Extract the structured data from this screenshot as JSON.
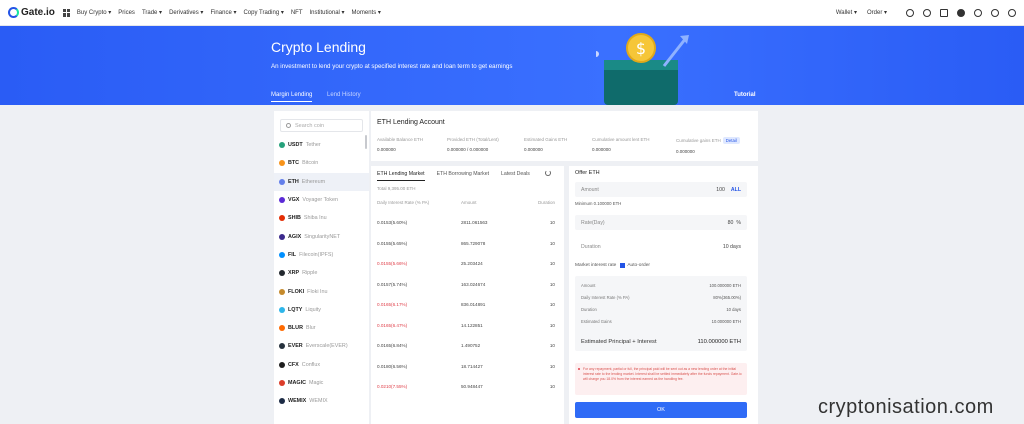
{
  "brand": {
    "name": "Gate.io"
  },
  "topnav": {
    "items": [
      "Buy Crypto ▾",
      "Prices",
      "Trade ▾",
      "Derivatives ▾",
      "Finance ▾",
      "Copy Trading ▾",
      "NFT",
      "Institutional ▾",
      "Moments ▾"
    ],
    "right_items": [
      "Wallet ▾",
      "Order ▾"
    ]
  },
  "hero": {
    "title": "Crypto Lending",
    "subtitle": "An investment to lend your crypto at specified interest rate and loan term to get earnings",
    "tabs": [
      "Margin Lending",
      "Lend History"
    ],
    "tutorial": "Tutorial"
  },
  "sidebar": {
    "search_placeholder": "Search coin",
    "coins": [
      {
        "symbol": "USDT",
        "name": "Tether",
        "color": "#26a17b"
      },
      {
        "symbol": "BTC",
        "name": "Bitcoin",
        "color": "#f7931a"
      },
      {
        "symbol": "ETH",
        "name": "Ethereum",
        "color": "#627eea"
      },
      {
        "symbol": "VGX",
        "name": "Voyager Token",
        "color": "#5b2ad6"
      },
      {
        "symbol": "SHIB",
        "name": "Shiba Inu",
        "color": "#e42d04"
      },
      {
        "symbol": "AGIX",
        "name": "SingularityNET",
        "color": "#3b2a8c"
      },
      {
        "symbol": "FIL",
        "name": "Filecoin(IPFS)",
        "color": "#0090ff"
      },
      {
        "symbol": "XRP",
        "name": "Ripple",
        "color": "#23292f"
      },
      {
        "symbol": "FLOKI",
        "name": "Floki Inu",
        "color": "#c58a2c"
      },
      {
        "symbol": "LQTY",
        "name": "Liquity",
        "color": "#2eb6ea"
      },
      {
        "symbol": "BLUR",
        "name": "Blur",
        "color": "#ff6a00"
      },
      {
        "symbol": "EVER",
        "name": "Everscale(EVER)",
        "color": "#26313d"
      },
      {
        "symbol": "CFX",
        "name": "Conflux",
        "color": "#1e1e1e"
      },
      {
        "symbol": "MAGIC",
        "name": "Magic",
        "color": "#dc3d2a"
      },
      {
        "symbol": "WEMIX",
        "name": "WEMIX",
        "color": "#1c2b45"
      }
    ]
  },
  "account": {
    "title": "ETH Lending Account",
    "stats": [
      {
        "label": "Available Balance ETH",
        "value": "0.000000"
      },
      {
        "label": "Provided ETH (Total/Lent)",
        "value": "0.000000 / 0.000000"
      },
      {
        "label": "Estimated Gains ETH",
        "value": "0.000000"
      },
      {
        "label": "Cumulative amount lent ETH",
        "value": "0.000000"
      },
      {
        "label": "Cumulative gains ETH",
        "value": "0.000000"
      }
    ],
    "detail_label": "Detail"
  },
  "market": {
    "tabs": [
      "ETH Lending Market",
      "ETH Borrowing Market",
      "Latest Deals"
    ],
    "total": "Total 9,395.00 ETH",
    "headers": [
      "Daily Interest Rate (% PA)",
      "Amount",
      "Duration"
    ],
    "rows": [
      {
        "rate": "0.0153(5.60%)",
        "amount": "2811.061563",
        "duration": "10",
        "red": false
      },
      {
        "rate": "0.0155(5.65%)",
        "amount": "865.729078",
        "duration": "10",
        "red": false
      },
      {
        "rate": "0.0155(5.66%)",
        "amount": "25.203424",
        "duration": "10",
        "red": true
      },
      {
        "rate": "0.0157(5.74%)",
        "amount": "163.024674",
        "duration": "10",
        "red": false
      },
      {
        "rate": "0.0165(6.17%)",
        "amount": "836.014891",
        "duration": "10",
        "red": true
      },
      {
        "rate": "0.0165(6.47%)",
        "amount": "14.122851",
        "duration": "10",
        "red": true
      },
      {
        "rate": "0.0165(6.84%)",
        "amount": "1.490752",
        "duration": "10",
        "red": false
      },
      {
        "rate": "0.0180(6.56%)",
        "amount": "18.714427",
        "duration": "10",
        "red": false
      },
      {
        "rate": "0.0210(7.55%)",
        "amount": "50.948447",
        "duration": "10",
        "red": true
      }
    ]
  },
  "offer": {
    "title": "Offer ETH",
    "amount_label": "Amount",
    "amount_value": "100",
    "all_label": "ALL",
    "minimum_note": "Minimum 0.100000 ETH",
    "rate_label": "Rate(Day)",
    "rate_value": "80",
    "rate_unit": "%",
    "duration_label": "Duration",
    "duration_value": "10 days",
    "market_rate_label": "Market interest rate",
    "auto_order_label": "Auto-order",
    "summary": [
      {
        "label": "Amount",
        "value": "100.000000 ETH"
      },
      {
        "label": "Daily Interest Rate (% PA)",
        "value": "80%(365.00%)"
      },
      {
        "label": "Duration",
        "value": "10 days"
      },
      {
        "label": "Estimated Gains",
        "value": "10.000000 ETH"
      }
    ],
    "estimated_label": "Estimated Principal + Interest",
    "estimated_value": "110.000000 ETH",
    "warning": "For any repayment, partial or full, the principal paid will be sent out as a new lending order at the initial interest rate to the lending market. Interest shall be settled immediately after the funds repayment. Gate.io will charge you 18.0% from the interest earned as the handling fee.",
    "ok_label": "OK"
  },
  "watermark": "cryptonisation.com"
}
